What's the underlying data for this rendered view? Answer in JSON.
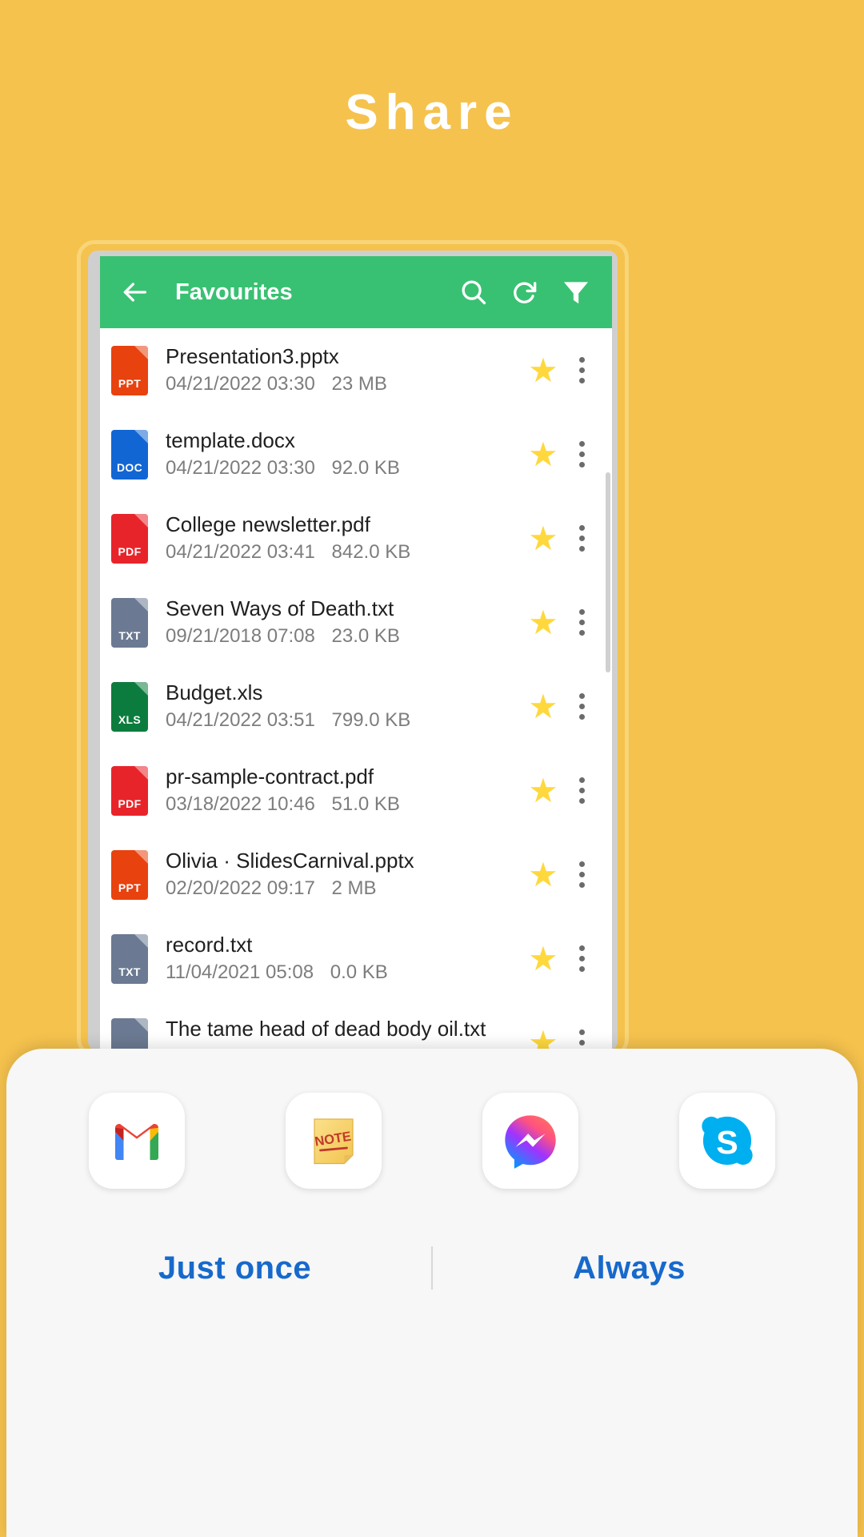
{
  "page": {
    "title": "Share",
    "background_color": "#f5c24d",
    "title_color": "#ffffff"
  },
  "app": {
    "accent_color": "#38c172",
    "toolbar": {
      "back_icon": "arrow-left-icon",
      "title": "Favourites",
      "actions": [
        {
          "name": "search-icon",
          "label": "Search"
        },
        {
          "name": "refresh-icon",
          "label": "Refresh"
        },
        {
          "name": "filter-icon",
          "label": "Filter"
        }
      ]
    },
    "file_list": {
      "star_color": "#ffd83d",
      "files": [
        {
          "name": "Presentation3.pptx",
          "date": "04/21/2022 03:30",
          "size": "23 MB",
          "type": "PPT",
          "color": "#e8420f",
          "starred": true
        },
        {
          "name": "template.docx",
          "date": "04/21/2022 03:30",
          "size": "92.0 KB",
          "type": "DOC",
          "color": "#1266d4",
          "starred": true
        },
        {
          "name": "College newsletter.pdf",
          "date": "04/21/2022 03:41",
          "size": "842.0 KB",
          "type": "PDF",
          "color": "#e8242b",
          "starred": true
        },
        {
          "name": "Seven Ways of Death.txt",
          "date": "09/21/2018 07:08",
          "size": "23.0 KB",
          "type": "TXT",
          "color": "#6b7a92",
          "starred": true
        },
        {
          "name": "Budget.xls",
          "date": "04/21/2022 03:51",
          "size": "799.0 KB",
          "type": "XLS",
          "color": "#0c7c3e",
          "starred": true
        },
        {
          "name": "pr-sample-contract.pdf",
          "date": "03/18/2022 10:46",
          "size": "51.0 KB",
          "type": "PDF",
          "color": "#e8242b",
          "starred": true
        },
        {
          "name": "Olivia · SlidesCarnival.pptx",
          "date": "02/20/2022 09:17",
          "size": "2 MB",
          "type": "PPT",
          "color": "#e8420f",
          "starred": true
        },
        {
          "name": "record.txt",
          "date": "11/04/2021 05:08",
          "size": "0.0 KB",
          "type": "TXT",
          "color": "#6b7a92",
          "starred": true
        },
        {
          "name": "The tame head of dead body oil.txt",
          "date": "",
          "size": "",
          "type": "TXT",
          "color": "#6b7a92",
          "starred": true
        }
      ]
    }
  },
  "share_sheet": {
    "apps": [
      {
        "name": "gmail-icon",
        "label": "Gmail"
      },
      {
        "name": "note-icon",
        "label": "Note"
      },
      {
        "name": "messenger-icon",
        "label": "Messenger"
      },
      {
        "name": "skype-icon",
        "label": "Skype"
      }
    ],
    "buttons": {
      "just_once": "Just once",
      "always": "Always",
      "color": "#1769cc"
    }
  }
}
